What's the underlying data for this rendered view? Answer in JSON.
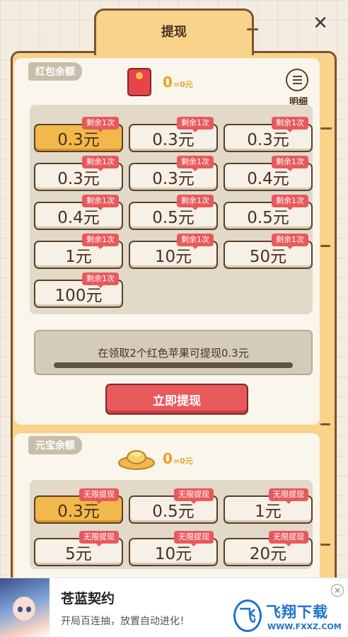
{
  "header": {
    "title": "提现"
  },
  "close": {
    "label": "✕"
  },
  "red_section": {
    "label": "红包余额",
    "balance_value": "0",
    "balance_unit": "=0元",
    "detail_label": "明细",
    "options": [
      {
        "amount": "0.3元",
        "badge": "剩余1次",
        "selected": true
      },
      {
        "amount": "0.3元",
        "badge": "剩余1次",
        "selected": false
      },
      {
        "amount": "0.3元",
        "badge": "剩余1次",
        "selected": false
      },
      {
        "amount": "0.3元",
        "badge": "剩余1次",
        "selected": false
      },
      {
        "amount": "0.3元",
        "badge": "剩余1次",
        "selected": false
      },
      {
        "amount": "0.4元",
        "badge": "剩余1次",
        "selected": false
      },
      {
        "amount": "0.4元",
        "badge": "剩余1次",
        "selected": false
      },
      {
        "amount": "0.5元",
        "badge": "剩余1次",
        "selected": false
      },
      {
        "amount": "0.5元",
        "badge": "剩余1次",
        "selected": false
      },
      {
        "amount": "1元",
        "badge": "剩余1次",
        "selected": false
      },
      {
        "amount": "10元",
        "badge": "剩余1次",
        "selected": false
      },
      {
        "amount": "50元",
        "badge": "剩余1次",
        "selected": false
      },
      {
        "amount": "100元",
        "badge": "剩余1次",
        "selected": false
      }
    ],
    "progress_text": "在领取2个红色苹果可提现0.3元",
    "progress_fraction": 0,
    "withdraw_label": "立即提现"
  },
  "yb_section": {
    "label": "元宝余额",
    "balance_value": "0",
    "balance_unit": "=0元",
    "options": [
      {
        "amount": "0.3元",
        "badge": "无限提现",
        "selected": true
      },
      {
        "amount": "0.5元",
        "badge": "无限提现",
        "selected": false
      },
      {
        "amount": "1元",
        "badge": "无限提现",
        "selected": false
      },
      {
        "amount": "5元",
        "badge": "无限提现",
        "selected": false
      },
      {
        "amount": "10元",
        "badge": "无限提现",
        "selected": false
      },
      {
        "amount": "20元",
        "badge": "无限提现",
        "selected": false
      }
    ]
  },
  "ad": {
    "title": "苍蓝契约",
    "subtitle": "开局百连抽，放置自动进化！",
    "close_label": "×",
    "logo_glyph": "飞",
    "brand": "飞翔下载",
    "site": "WWW.FXXZ.COM"
  },
  "colors": {
    "accent_gold": "#f2b84b",
    "accent_red": "#e8595c",
    "frame_brown": "#7c5433",
    "balance_orange": "#e8a126"
  }
}
